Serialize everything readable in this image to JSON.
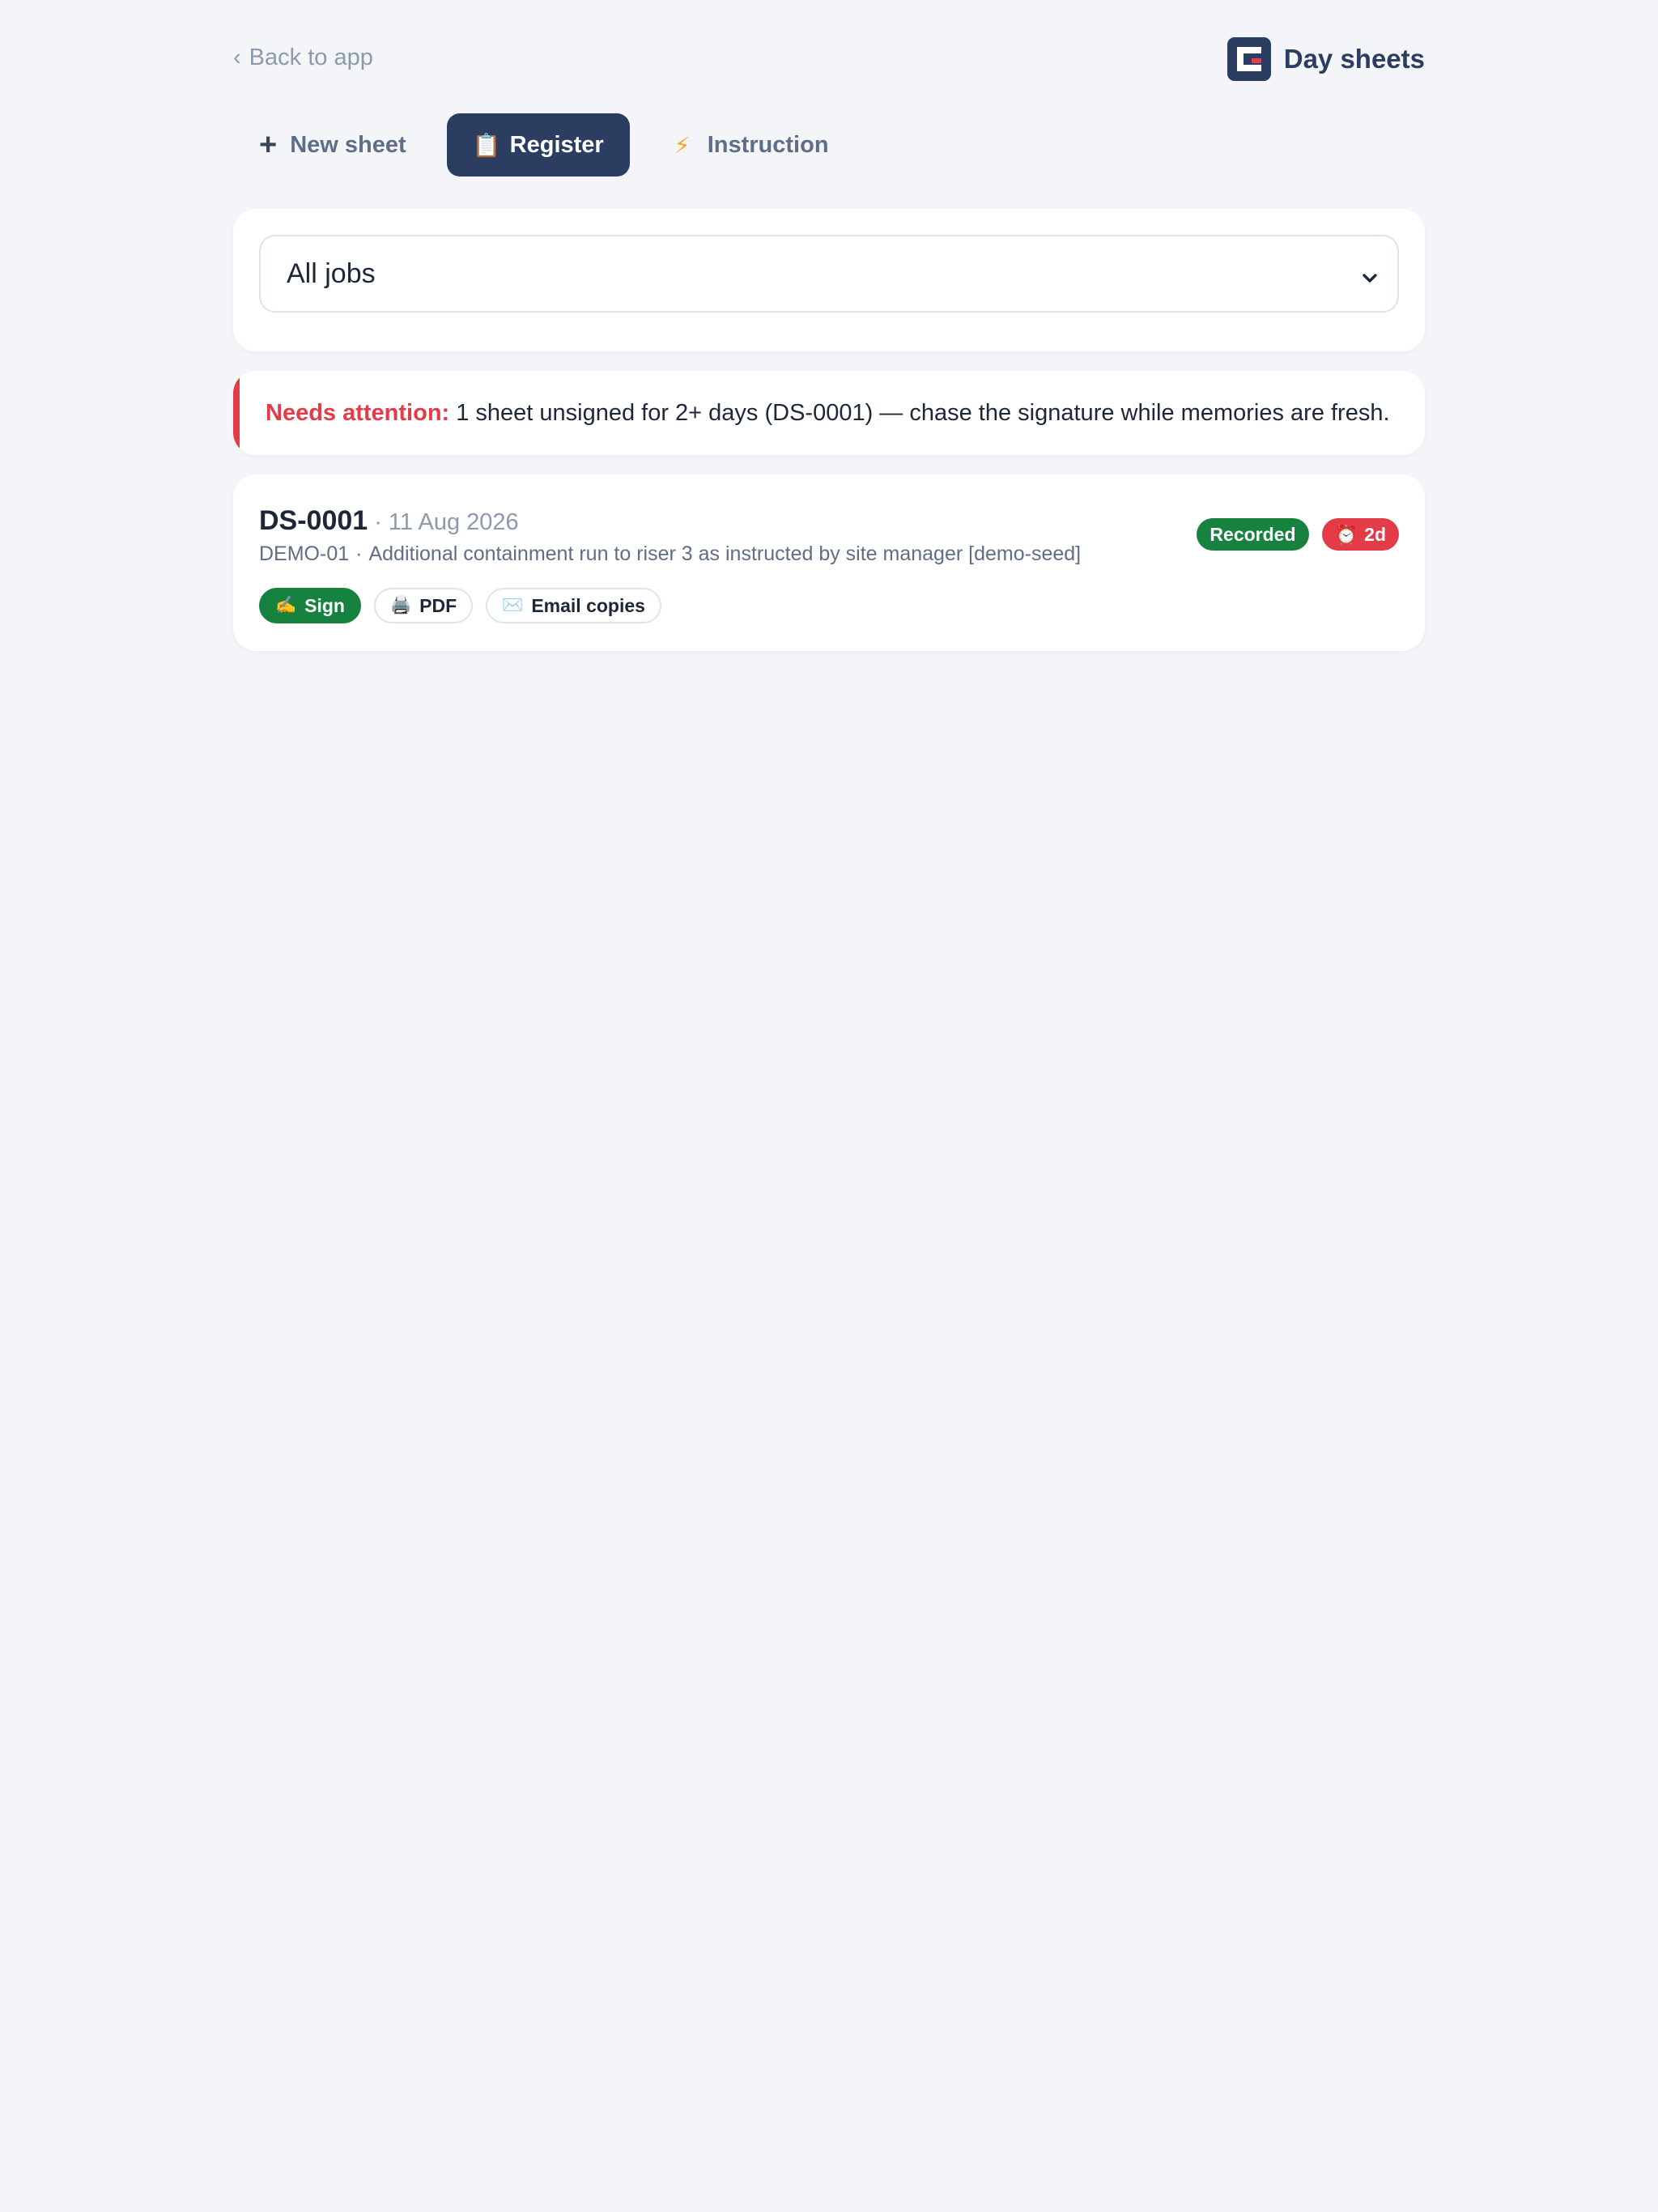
{
  "header": {
    "back_label": "Back to app",
    "brand_name": "Day sheets"
  },
  "tabs": [
    {
      "label": "New sheet",
      "icon": "plus-icon",
      "active": false
    },
    {
      "label": "Register",
      "icon": "clipboard-icon",
      "active": true
    },
    {
      "label": "Instruction",
      "icon": "lightning-icon",
      "active": false
    }
  ],
  "filter": {
    "selected": "All jobs"
  },
  "attention": {
    "label": "Needs attention:",
    "message": "1 sheet unsigned for 2+ days (DS-0001) — chase the signature while memories are fresh."
  },
  "sheets": [
    {
      "id": "DS-0001",
      "date": "· 11 Aug 2026",
      "job": "DEMO-01",
      "separator": "·",
      "description": "Additional containment run to riser 3 as instructed by site manager [demo-seed]",
      "status": "Recorded",
      "age": "2d",
      "actions": {
        "sign": "Sign",
        "pdf": "PDF",
        "email": "Email copies"
      }
    }
  ],
  "colors": {
    "brand": "#2c3d62",
    "success": "#17823f",
    "danger": "#e33b47",
    "background": "#f3f5f9"
  }
}
